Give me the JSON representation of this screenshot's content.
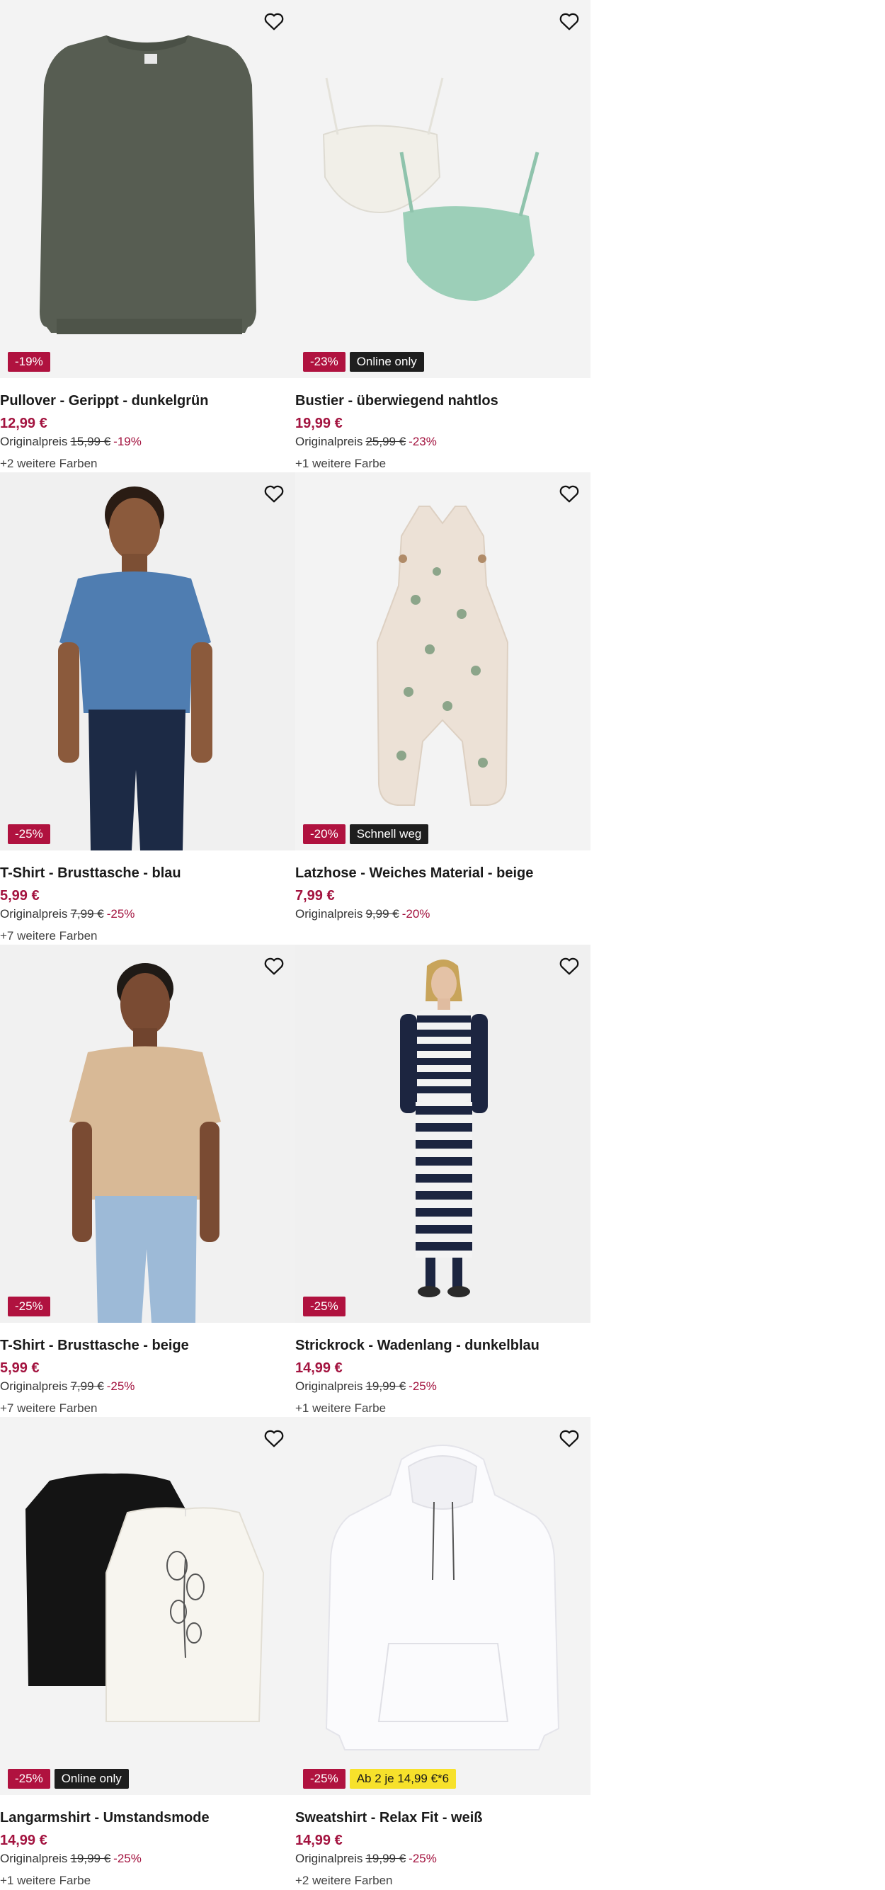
{
  "colors": {
    "discount": "#b0123f",
    "price": "#a3133f",
    "dark_badge": "#1e1e1e",
    "yellow_badge": "#f7e12b"
  },
  "products": [
    {
      "title": "Pullover - Gerippt - dunkelgrün",
      "price": "12,99 €",
      "orig_label": "Originalpreis",
      "orig_price": "15,99 €",
      "orig_pct": "-19%",
      "colors_text": "+2 weitere Farben",
      "badge_discount": "-19%",
      "badge_extra": "",
      "image": "green-ribbed-pullover"
    },
    {
      "title": "Bustier - überwiegend nahtlos",
      "price": "19,99 €",
      "orig_label": "Originalpreis",
      "orig_price": "25,99 €",
      "orig_pct": "-23%",
      "colors_text": "+1 weitere Farbe",
      "badge_discount": "-23%",
      "badge_extra": "Online only",
      "image": "two-bustiers"
    },
    {
      "title": "T-Shirt - Brusttasche - blau",
      "price": "5,99 €",
      "orig_label": "Originalpreis",
      "orig_price": "7,99 €",
      "orig_pct": "-25%",
      "colors_text": "+7 weitere Farben",
      "badge_discount": "-25%",
      "badge_extra": "",
      "image": "man-blue-tshirt"
    },
    {
      "title": "Latzhose - Weiches Material - beige",
      "price": "7,99 €",
      "orig_label": "Originalpreis",
      "orig_price": "9,99 €",
      "orig_pct": "-20%",
      "colors_text": "",
      "badge_discount": "-20%",
      "badge_extra": "Schnell weg",
      "image": "beige-dino-overalls"
    },
    {
      "title": "T-Shirt - Brusttasche - beige",
      "price": "5,99 €",
      "orig_label": "Originalpreis",
      "orig_price": "7,99 €",
      "orig_pct": "-25%",
      "colors_text": "+7 weitere Farben",
      "badge_discount": "-25%",
      "badge_extra": "",
      "image": "man-beige-tshirt"
    },
    {
      "title": "Strickrock - Wadenlang - dunkelblau",
      "price": "14,99 €",
      "orig_label": "Originalpreis",
      "orig_price": "19,99 €",
      "orig_pct": "-25%",
      "colors_text": "+1 weitere Farbe",
      "badge_discount": "-25%",
      "badge_extra": "",
      "image": "woman-striped-knit-skirt"
    },
    {
      "title": "Langarmshirt - Umstandsmode",
      "price": "14,99 €",
      "orig_label": "Originalpreis",
      "orig_price": "19,99 €",
      "orig_pct": "-25%",
      "colors_text": "+1 weitere Farbe",
      "badge_discount": "-25%",
      "badge_extra": "Online only",
      "image": "maternity-longsleeves"
    },
    {
      "title": "Sweatshirt - Relax Fit - weiß",
      "price": "14,99 €",
      "orig_label": "Originalpreis",
      "orig_price": "19,99 €",
      "orig_pct": "-25%",
      "colors_text": "+2 weitere Farben",
      "badge_discount": "-25%",
      "badge_extra": "Ab 2 je 14,99 €*6",
      "badge_extra_style": "yellow",
      "image": "white-hoodie"
    }
  ],
  "icons": {
    "wishlist": "heart-icon"
  }
}
